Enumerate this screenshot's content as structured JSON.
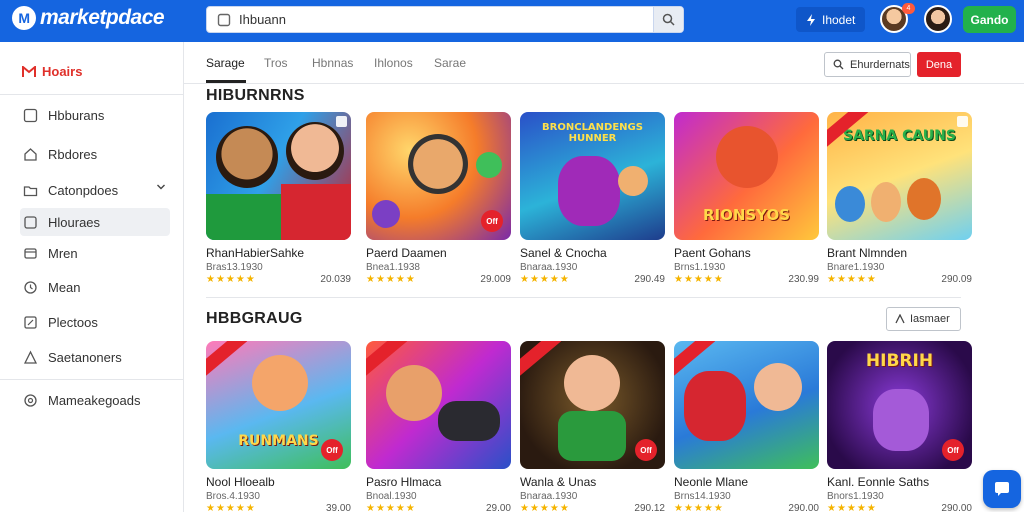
{
  "header": {
    "logo_text": "marketpdace",
    "search_value": "Ihbuann",
    "action_button": "Ihodet",
    "notification_count": "4",
    "cta_label": "Gando"
  },
  "sidebar": {
    "brand": "Hoairs",
    "items": [
      {
        "label": "Hbburans",
        "icon": "image-icon"
      },
      {
        "label": "Rbdores",
        "icon": "tag-icon"
      },
      {
        "label": "Catonpdoes",
        "icon": "folder-icon"
      },
      {
        "label": "Hlouraes",
        "icon": "cube-icon"
      },
      {
        "label": "Mren",
        "icon": "grid-icon"
      },
      {
        "label": "Mean",
        "icon": "clock-icon"
      },
      {
        "label": "Plectoos",
        "icon": "edit-icon"
      },
      {
        "label": "Saetanoners",
        "icon": "user-icon"
      },
      {
        "label": "Mameakegoads",
        "icon": "settings-icon"
      }
    ]
  },
  "tabs": [
    "Sarage",
    "Tros",
    "Hbnnas",
    "Ihlonos",
    "Sarae"
  ],
  "toolbar": {
    "filter_label": "Ehurdernats",
    "red_label": "Dena"
  },
  "sections": [
    {
      "title": "HIBURNRNS",
      "cards": [
        {
          "title": "RhanHabierSahke",
          "sub": "Bras13.1930",
          "price": "20.039"
        },
        {
          "title": "Paerd Daamen",
          "sub": "Bnea1.1938",
          "price": "29.009"
        },
        {
          "title": "Sanel & Cnocha",
          "sub": "Bnaraa.1930",
          "price": "290.49"
        },
        {
          "title": "Paent Gohans",
          "sub": "Brns1.1930",
          "price": "230.99"
        },
        {
          "title": "Brant Nlmnden",
          "sub": "Bnare1.1930",
          "price": "290.09"
        }
      ]
    },
    {
      "title": "HBBGRAUG",
      "more_label": "Iasmaer",
      "cards": [
        {
          "title": "Nool Hloealb",
          "sub": "Bros.4.1930",
          "price": "39.00"
        },
        {
          "title": "Pasro Hlmaca",
          "sub": "Bnoal.1930",
          "price": "29.00"
        },
        {
          "title": "Wanla & Unas",
          "sub": "Bnaraa.1930",
          "price": "290.12"
        },
        {
          "title": "Neonle Mlane",
          "sub": "Brns14.1930",
          "price": "290.00"
        },
        {
          "title": "Kanl. Eonnle Saths",
          "sub": "Bnors1.1930",
          "price": "290.00"
        }
      ]
    }
  ],
  "thumb_texts": {
    "c1_2": "BRONCLANDENGS HUNNER",
    "c1_3": "RIONSYOS",
    "c1_4": "SARNA CAUNS",
    "c2_0": "RUNMANS",
    "c2_4": "HIBRIH"
  },
  "sale_label": "Off",
  "stars": "★★★★★",
  "colors": {
    "brand_blue": "#1565e0",
    "accent_red": "#e4222b",
    "cta_green": "#22b14c",
    "star_gold": "#f5b400"
  }
}
